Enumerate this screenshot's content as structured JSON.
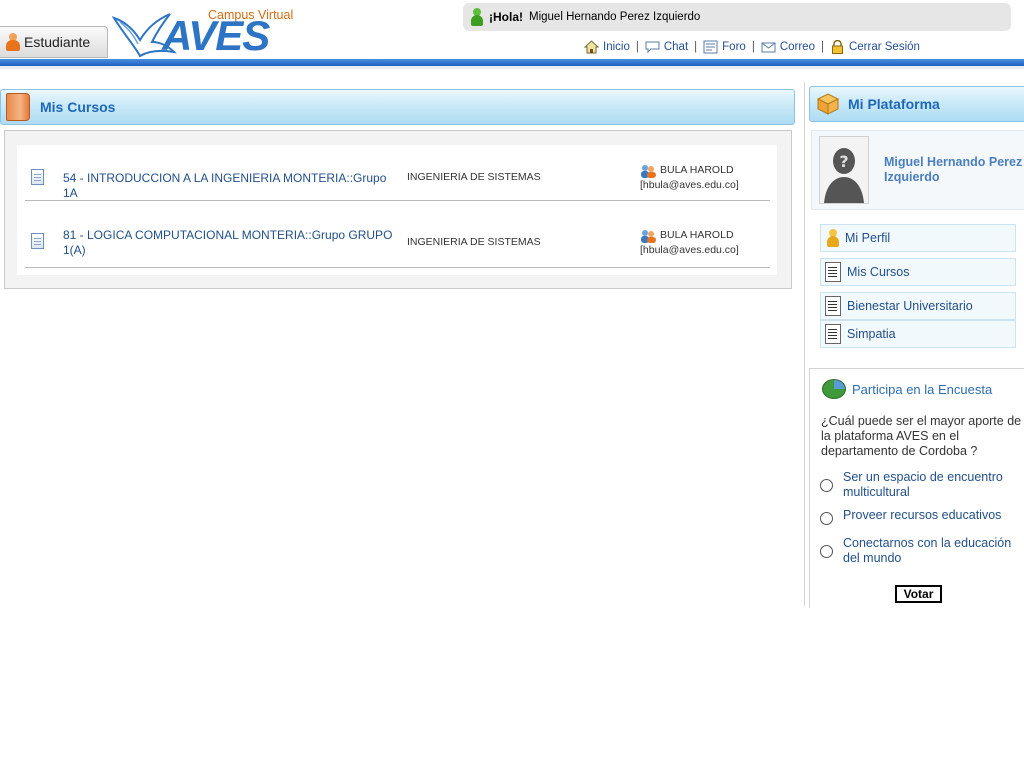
{
  "header": {
    "role_label": "Estudiante",
    "logo": {
      "campus_text": "Campus Virtual",
      "brand": "AVES"
    },
    "greeting": {
      "hola": "¡Hola!",
      "user_name": "Miguel Hernando Perez Izquierdo"
    },
    "nav": [
      {
        "label": "Inicio",
        "icon": "home-icon"
      },
      {
        "label": "Chat",
        "icon": "chat-icon"
      },
      {
        "label": "Foro",
        "icon": "forum-icon"
      },
      {
        "label": "Correo",
        "icon": "mail-icon"
      },
      {
        "label": "Cerrar Sesión",
        "icon": "lock-icon"
      }
    ]
  },
  "main": {
    "title": "Mis Cursos",
    "courses": [
      {
        "name": "54 - INTRODUCCION A LA INGENIERIA MONTERIA::Grupo 1A",
        "program": "INGENIERIA DE SISTEMAS",
        "teacher": "BULA HAROLD",
        "email": "[hbula@aves.edu.co]"
      },
      {
        "name": "81 - LOGICA COMPUTACIONAL MONTERIA::Grupo GRUPO 1(A)",
        "program": "INGENIERIA DE SISTEMAS",
        "teacher": "BULA HAROLD",
        "email": "[hbula@aves.edu.co]"
      }
    ]
  },
  "sidebar": {
    "title": "Mi Plataforma",
    "profile_name": "Miguel Hernando Perez Izquierdo",
    "links": [
      {
        "label": "Mi Perfil",
        "icon": "user-icon"
      },
      {
        "label": "Mis Cursos",
        "icon": "list-icon"
      },
      {
        "label": "Bienestar Universitario",
        "icon": "list-icon"
      },
      {
        "label": "Simpatia",
        "icon": "list-icon"
      }
    ],
    "survey": {
      "title": "Participa en la Encuesta",
      "question": "¿Cuál puede ser el mayor aporte de la plataforma AVES en el departamento de Cordoba ?",
      "options": [
        "Ser un espacio de encuentro multicultural",
        "Proveer recursos educativos",
        "Conectarnos con la educación del mundo"
      ],
      "vote_label": "Votar"
    }
  },
  "colors": {
    "accent_blue": "#2d74c4",
    "link": "#23508a",
    "header_bar": "#1f62c0",
    "logo_orange": "#d76b12"
  }
}
